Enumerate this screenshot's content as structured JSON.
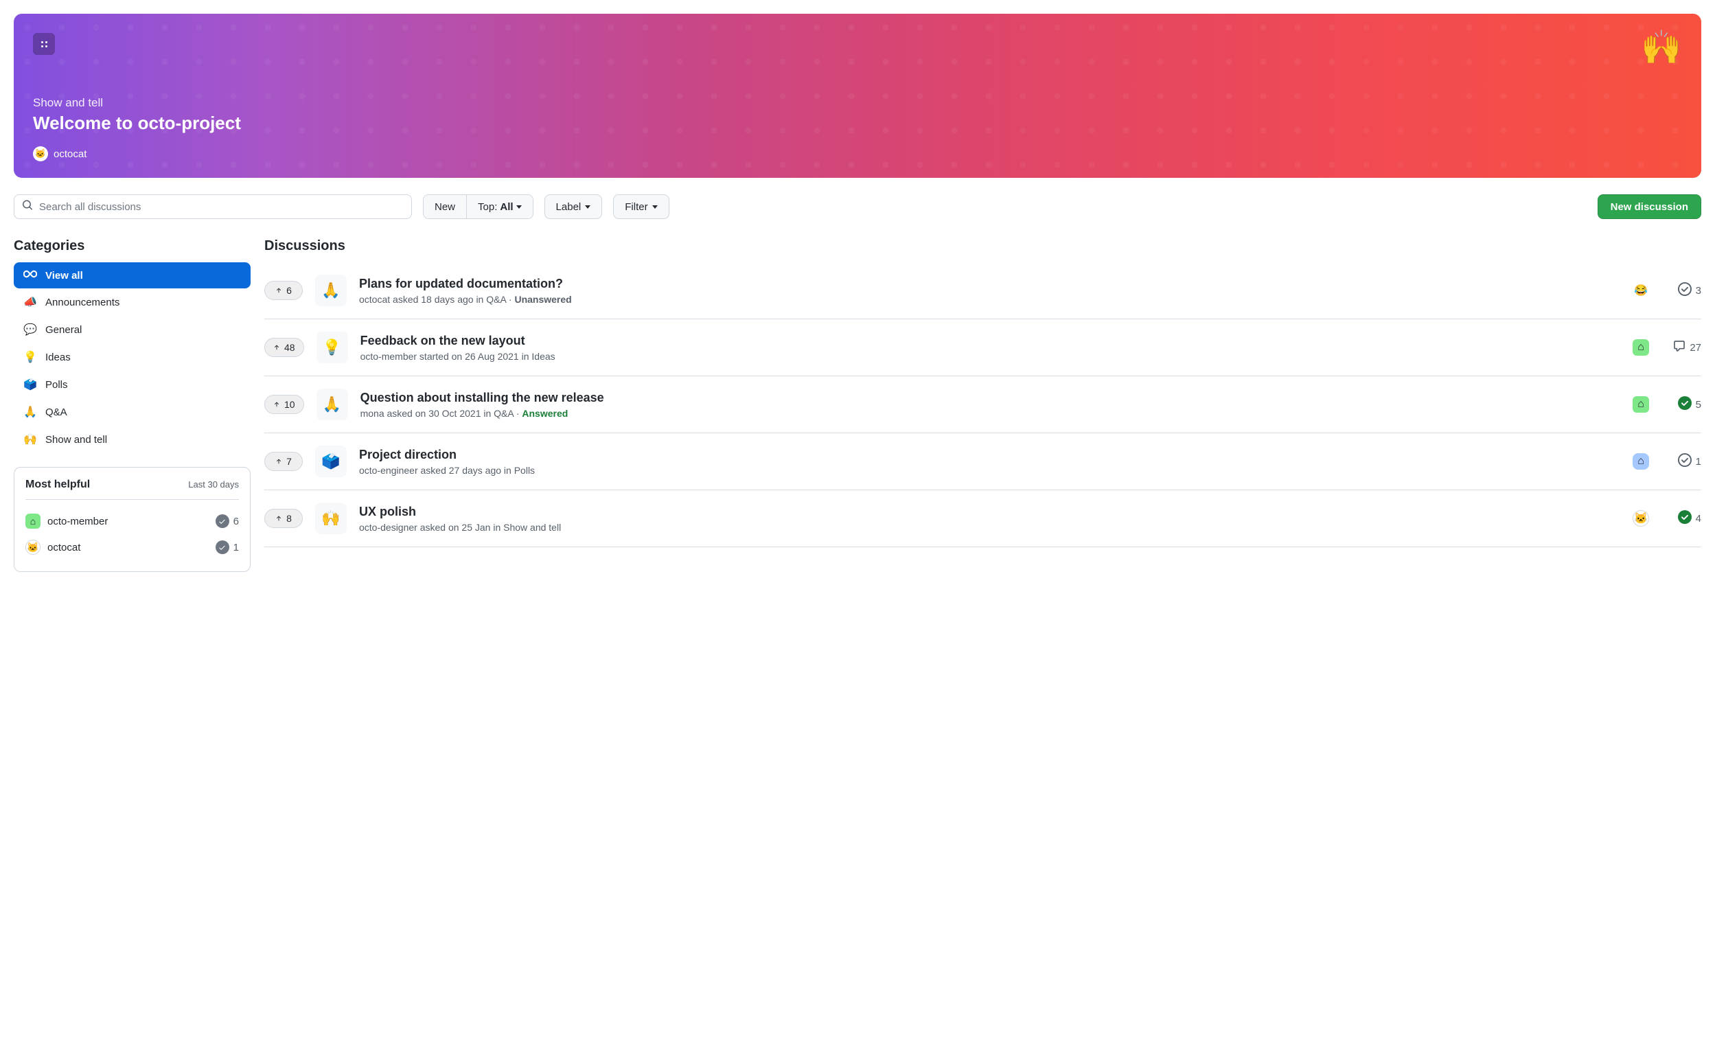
{
  "hero": {
    "category": "Show and tell",
    "title": "Welcome to octo-project",
    "author": "octocat",
    "emoji": "🙌"
  },
  "search": {
    "placeholder": "Search all discussions"
  },
  "filters": {
    "new_label": "New",
    "top_prefix": "Top: ",
    "top_value": "All",
    "label_label": "Label",
    "filter_label": "Filter"
  },
  "new_button": "New discussion",
  "sidebar_heading": "Categories",
  "categories": [
    {
      "label": "View all",
      "icon": "infinity",
      "active": true
    },
    {
      "label": "Announcements",
      "icon": "📣",
      "active": false
    },
    {
      "label": "General",
      "icon": "💬",
      "active": false
    },
    {
      "label": "Ideas",
      "icon": "💡",
      "active": false
    },
    {
      "label": "Polls",
      "icon": "🗳️",
      "active": false
    },
    {
      "label": "Q&A",
      "icon": "🙏",
      "active": false
    },
    {
      "label": "Show and tell",
      "icon": "🙌",
      "active": false
    }
  ],
  "helpful": {
    "title": "Most helpful",
    "period": "Last 30 days",
    "users": [
      {
        "name": "octo-member",
        "count": "6",
        "avatar": "green",
        "glyph": "⌂"
      },
      {
        "name": "octocat",
        "count": "1",
        "avatar": "white",
        "glyph": "🐱"
      }
    ]
  },
  "main_heading": "Discussions",
  "discussions": [
    {
      "votes": "6",
      "icon": "🙏",
      "title": "Plans for updated documentation?",
      "meta": "octocat asked 18 days ago in Q&A · ",
      "status": "Unanswered",
      "status_class": "unanswered",
      "avatar_class": "emoji-bg",
      "avatar_glyph": "😂",
      "comments": "3",
      "check": "outline"
    },
    {
      "votes": "48",
      "icon": "💡",
      "title": "Feedback on the new layout",
      "meta": "octo-member started on 26 Aug 2021 in Ideas",
      "status": "",
      "status_class": "",
      "avatar_class": "green",
      "avatar_glyph": "⌂",
      "comments": "27",
      "check": "comment"
    },
    {
      "votes": "10",
      "icon": "🙏",
      "title": "Question about installing the new release",
      "meta": "mona asked on 30 Oct 2021 in Q&A · ",
      "status": "Answered",
      "status_class": "answered",
      "avatar_class": "green",
      "avatar_glyph": "⌂",
      "comments": "5",
      "check": "filled"
    },
    {
      "votes": "7",
      "icon": "🗳️",
      "title": "Project direction",
      "meta": "octo-engineer asked 27 days ago in Polls",
      "status": "",
      "status_class": "",
      "avatar_class": "blue",
      "avatar_glyph": "⌂",
      "comments": "1",
      "check": "outline"
    },
    {
      "votes": "8",
      "icon": "🙌",
      "title": "UX polish",
      "meta": "octo-designer asked on 25 Jan in Show and tell",
      "status": "",
      "status_class": "",
      "avatar_class": "white",
      "avatar_glyph": "🐱",
      "comments": "4",
      "check": "filled"
    }
  ]
}
